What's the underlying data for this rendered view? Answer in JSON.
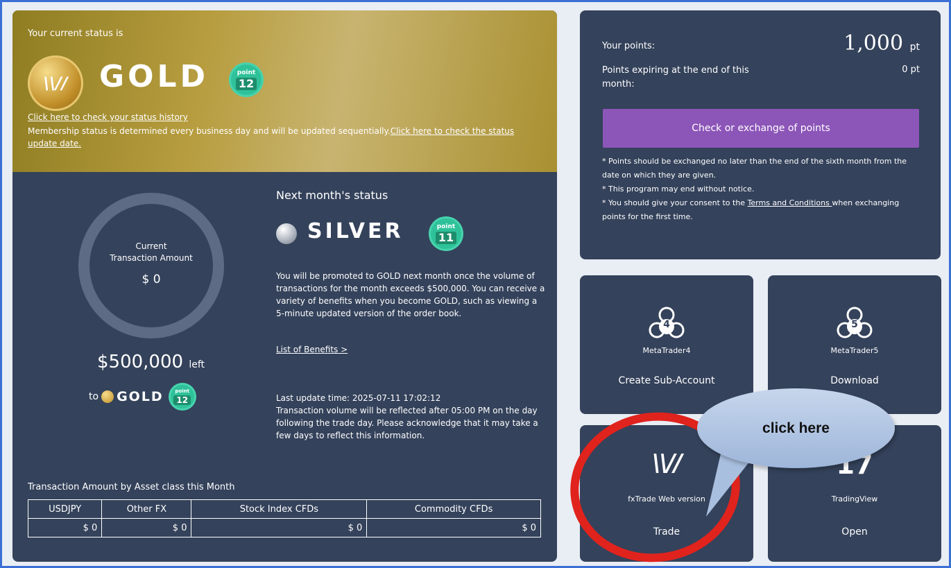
{
  "status": {
    "intro": "Your current status is",
    "level": "GOLD",
    "badge_top": "point",
    "badge_num": "12",
    "history_link": "Click here to check your status history",
    "membership_text": "Membership status is determined every business day and will be updated sequentially.",
    "update_date_link": "Click here to check the status update date."
  },
  "transaction": {
    "ring_label_line1": "Current",
    "ring_label_line2": "Transaction Amount",
    "current_amount": "$ 0",
    "left_amount": "$500,000",
    "left_suffix": "left",
    "to": "to",
    "to_level": "GOLD",
    "to_badge_top": "point",
    "to_badge_num": "12"
  },
  "next_month": {
    "title": "Next month's status",
    "level": "SILVER",
    "badge_top": "point",
    "badge_num": "11",
    "promo_text": "You will be promoted to GOLD next month once the volume of transactions for the month exceeds $500,000. You can receive a variety of benefits when you become GOLD, such as viewing a 5-minute updated version of the order book.",
    "benefits_link": "List of Benefits >",
    "update_text_line1": "Last update time: 2025-07-11 17:02:12",
    "update_text_line2": "Transaction volume will be reflected after 05:00 PM on the day following the trade day. Please acknowledge that it may take a few days to reflect this information."
  },
  "assets": {
    "title": "Transaction Amount by Asset class this Month",
    "headers": [
      "USDJPY",
      "Other FX",
      "Stock Index CFDs",
      "Commodity CFDs"
    ],
    "values": [
      "$ 0",
      "$ 0",
      "$ 0",
      "$ 0"
    ]
  },
  "points": {
    "label": "Your points:",
    "value": "1,000",
    "unit": "pt",
    "expiring_label": "Points expiring at the end of this month:",
    "expiring_value": "0 pt",
    "exchange_button": "Check or exchange of points",
    "note1": "* Points should be exchanged no later than the end of the sixth month from the date on which they are given.",
    "note2": "* This program may end without notice.",
    "note3_before": "* You should give your consent to the ",
    "note3_link": "Terms and Conditions ",
    "note3_after": "when exchanging points for the first time."
  },
  "apps": {
    "mt4": {
      "icon_num": "4",
      "name": "MetaTrader4",
      "action": "Create Sub-Account"
    },
    "mt5": {
      "icon_num": "5",
      "name": "MetaTrader5",
      "action": "Download"
    },
    "fxtrade": {
      "name": "fxTrade Web version",
      "action": "Trade"
    },
    "tv": {
      "logo": "17",
      "name": "TradingView",
      "action": "Open"
    }
  },
  "annotation": {
    "bubble_text": "click here"
  },
  "colors": {
    "card_bg": "#34425b",
    "page_bg": "#e9edf4",
    "exchange_btn": "#8c55b8",
    "annotation_red": "#e0231d",
    "badge_green": "#2fc29a"
  }
}
